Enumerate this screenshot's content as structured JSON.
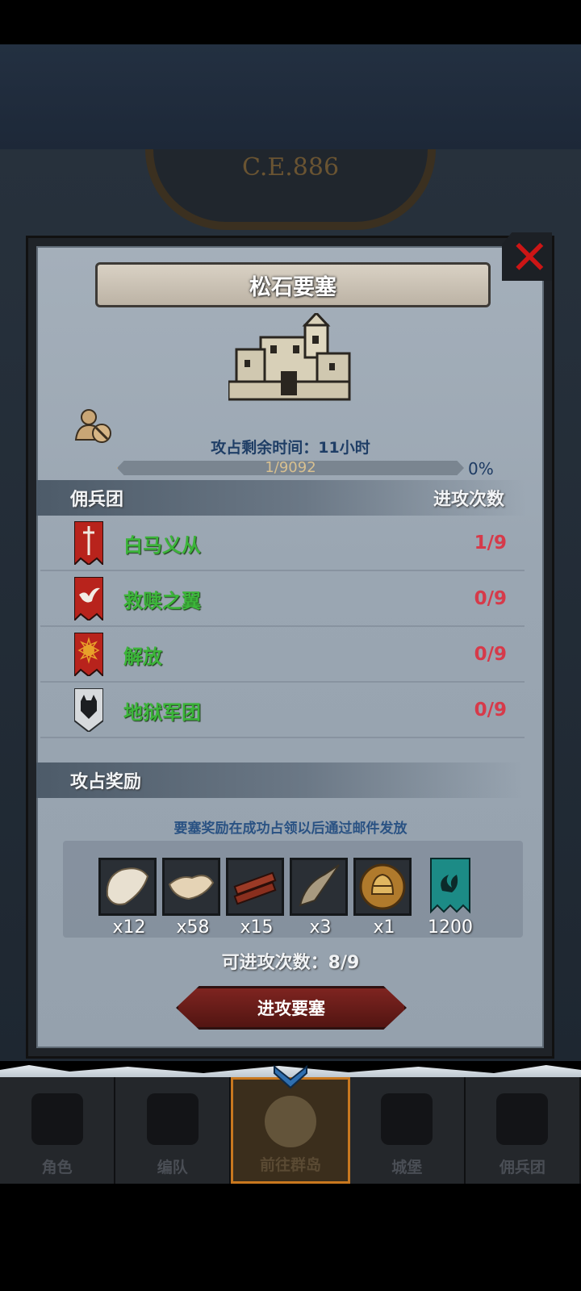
{
  "header": {
    "era": "C.E.886"
  },
  "dialog": {
    "title": "松石要塞",
    "time_label": "攻占剩余时间：",
    "time_value": "11小时",
    "progress_text": "1/9092",
    "progress_percent": "0%",
    "progress_fraction": 0.0001,
    "mercenary_header": "佣兵团",
    "attack_count_header": "进攻次数",
    "mercenaries": [
      {
        "name": "白马义从",
        "count": "1/9",
        "banner": "sword-banner-icon",
        "color": "#b8231c"
      },
      {
        "name": "救赎之翼",
        "count": "0/9",
        "banner": "bird-banner-icon",
        "color": "#b8231c"
      },
      {
        "name": "解放",
        "count": "0/9",
        "banner": "sunburst-banner-icon",
        "color": "#b8231c"
      },
      {
        "name": "地狱军团",
        "count": "0/9",
        "banner": "wolf-banner-icon",
        "color": "#d7dadd"
      }
    ],
    "reward_header": "攻占奖励",
    "reward_note": "要塞奖励在成功占领以后通过邮件发放",
    "rewards": [
      {
        "icon": "fur-pelt-icon",
        "qty": "x12"
      },
      {
        "icon": "leather-hide-icon",
        "qty": "x58"
      },
      {
        "icon": "wood-planks-icon",
        "qty": "x15"
      },
      {
        "icon": "horn-icon",
        "qty": "x3"
      },
      {
        "icon": "helmet-coin-icon",
        "qty": "x1"
      },
      {
        "icon": "guild-flag-icon",
        "qty": "1200"
      }
    ],
    "attempts_label": "可进攻次数：8/9",
    "attack_button": "进攻要塞"
  },
  "nav": {
    "items": [
      {
        "label": "角色"
      },
      {
        "label": "编队"
      },
      {
        "label": "前往群岛"
      },
      {
        "label": "城堡"
      },
      {
        "label": "佣兵团"
      }
    ]
  }
}
